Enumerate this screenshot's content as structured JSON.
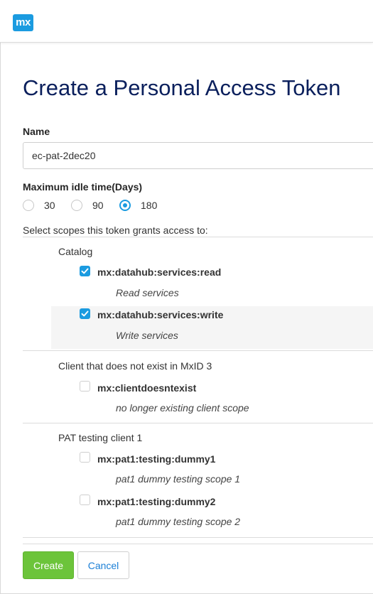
{
  "header": {
    "logo_text": "mx"
  },
  "page": {
    "title": "Create a Personal Access Token"
  },
  "form": {
    "name_label": "Name",
    "name_value": "ec-pat-2dec20",
    "idle_label": "Maximum idle time(Days)",
    "idle_options": [
      "30",
      "90",
      "180"
    ],
    "idle_selected": "180",
    "scopes_intro": "Select scopes this token grants access to:"
  },
  "clients": [
    {
      "name": "Catalog",
      "scopes": [
        {
          "name": "mx:datahub:services:read",
          "description": "Read services",
          "checked": true
        },
        {
          "name": "mx:datahub:services:write",
          "description": "Write services",
          "checked": true
        }
      ]
    },
    {
      "name": "Client that does not exist in MxID 3",
      "scopes": [
        {
          "name": "mx:clientdoesntexist",
          "description": "no longer existing client scope",
          "checked": false
        }
      ]
    },
    {
      "name": "PAT testing client 1",
      "scopes": [
        {
          "name": "mx:pat1:testing:dummy1",
          "description": "pat1 dummy testing scope 1",
          "checked": false
        },
        {
          "name": "mx:pat1:testing:dummy2",
          "description": "pat1 dummy testing scope 2",
          "checked": false
        }
      ]
    }
  ],
  "actions": {
    "create_label": "Create",
    "cancel_label": "Cancel"
  },
  "colors": {
    "accent": "#1b9be0",
    "title": "#0a1f5c",
    "create": "#6cc43a",
    "cancel_text": "#1b7fd6"
  }
}
